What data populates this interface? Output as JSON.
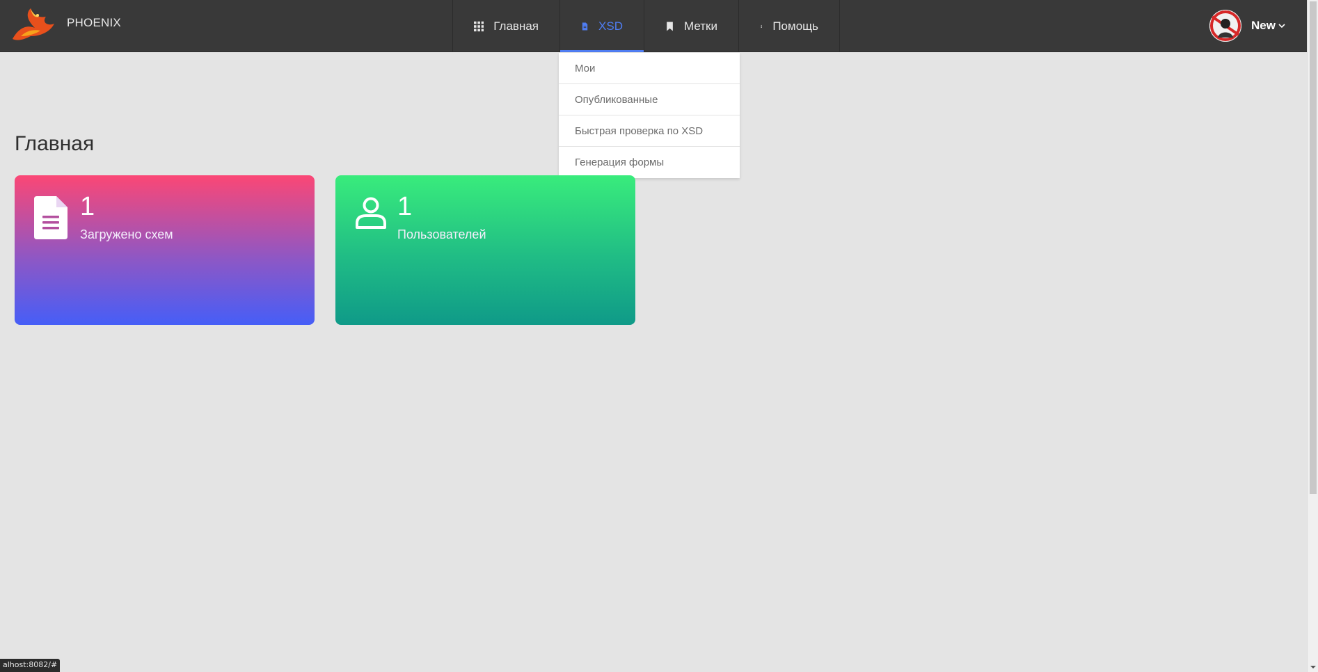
{
  "brand": {
    "name": "PHOENIX",
    "icon": "phoenix-logo"
  },
  "nav": {
    "items": [
      {
        "label": "Главная",
        "icon": "grid-icon"
      },
      {
        "label": "XSD",
        "icon": "document-icon"
      },
      {
        "label": "Метки",
        "icon": "bookmark-icon"
      },
      {
        "label": "Помощь",
        "icon": "info-icon"
      }
    ],
    "active_index": 1
  },
  "user": {
    "name": "New",
    "icon": "chevron-down-icon"
  },
  "xsd_menu": {
    "items": [
      "Мои",
      "Опубликованные",
      "Быстрая проверка по XSD",
      "Генерация формы"
    ]
  },
  "page": {
    "title": "Главная"
  },
  "cards": [
    {
      "count": "1",
      "label": "Загружено схем",
      "icon": "file-icon"
    },
    {
      "count": "1",
      "label": "Пользователей",
      "icon": "user-icon"
    }
  ],
  "status_bar": {
    "url": "alhost:8082/#"
  },
  "colors": {
    "navbar": "#393939",
    "accent": "#4f7df2",
    "background": "#e4e4e4",
    "card_schemas_top": "#fb4775",
    "card_schemas_bottom": "#465ef7",
    "card_users_top": "#39ec7c",
    "card_users_bottom": "#0f9a88"
  }
}
